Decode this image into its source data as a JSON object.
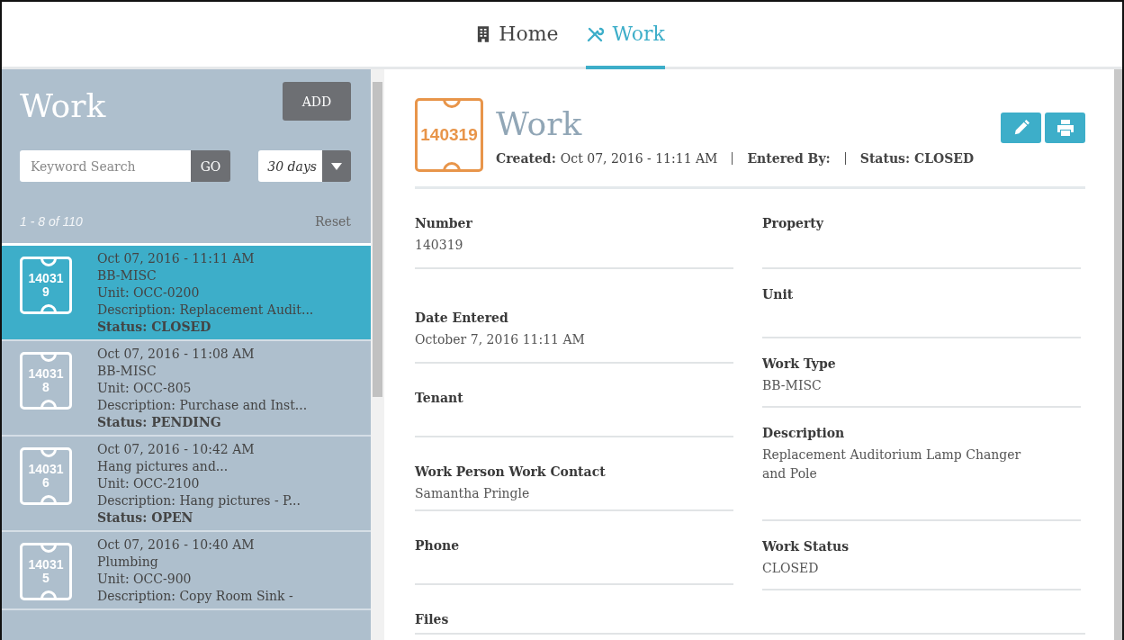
{
  "nav": {
    "tabs": [
      {
        "label": "Home",
        "selected": false
      },
      {
        "label": "Work",
        "selected": true
      }
    ]
  },
  "sidebar": {
    "title": "Work",
    "add_button": "ADD",
    "search": {
      "placeholder": "Keyword Search",
      "button": "GO"
    },
    "range": {
      "value": "30 days"
    },
    "count": "1 - 8 of 110",
    "reset": "Reset",
    "items": [
      {
        "number": "140319",
        "date": "Oct 07, 2016 - 11:11 AM",
        "type": "BB-MISC",
        "unit": "Unit: OCC-0200",
        "description": "Description: Replacement Audit...",
        "status": "Status: CLOSED",
        "selected": true
      },
      {
        "number": "140318",
        "date": "Oct 07, 2016 - 11:08 AM",
        "type": "BB-MISC",
        "unit": "Unit: OCC-805",
        "description": "Description: Purchase and Inst...",
        "status": "Status: PENDING",
        "selected": false
      },
      {
        "number": "140316",
        "date": "Oct 07, 2016 - 10:42 AM",
        "type": "Hang pictures and...",
        "unit": "Unit: OCC-2100",
        "description": "Description: Hang pictures - P...",
        "status": "Status: OPEN",
        "selected": false
      },
      {
        "number": "140315",
        "date": "Oct 07, 2016 - 10:40 AM",
        "type": "Plumbing",
        "unit": "Unit: OCC-900",
        "description": "Description: Copy Room Sink -",
        "selected": false
      }
    ]
  },
  "detail": {
    "number": "140319",
    "title": "Work",
    "meta": [
      {
        "label": "Created:",
        "value": "Oct 07, 2016 - 11:11 AM"
      },
      {
        "label": "Entered By:"
      },
      {
        "label": "Status: CLOSED"
      }
    ],
    "left_fields": [
      {
        "label": "Number",
        "value": "140319"
      },
      {
        "label": "Date Entered",
        "value": "October 7, 2016 11:11 AM"
      },
      {
        "label": "Tenant"
      },
      {
        "label": "Work Person Work Contact",
        "value": "Samantha Pringle"
      },
      {
        "label": "Phone"
      }
    ],
    "right_fields": [
      {
        "label": "Property"
      },
      {
        "label": "Unit"
      },
      {
        "label": "Work Type",
        "value": "BB-MISC"
      },
      {
        "label": "Description",
        "value": "Replacement Auditorium Lamp Changer and Pole"
      },
      {
        "label": "Work Status",
        "value": "CLOSED"
      }
    ],
    "files_label": "Files"
  }
}
